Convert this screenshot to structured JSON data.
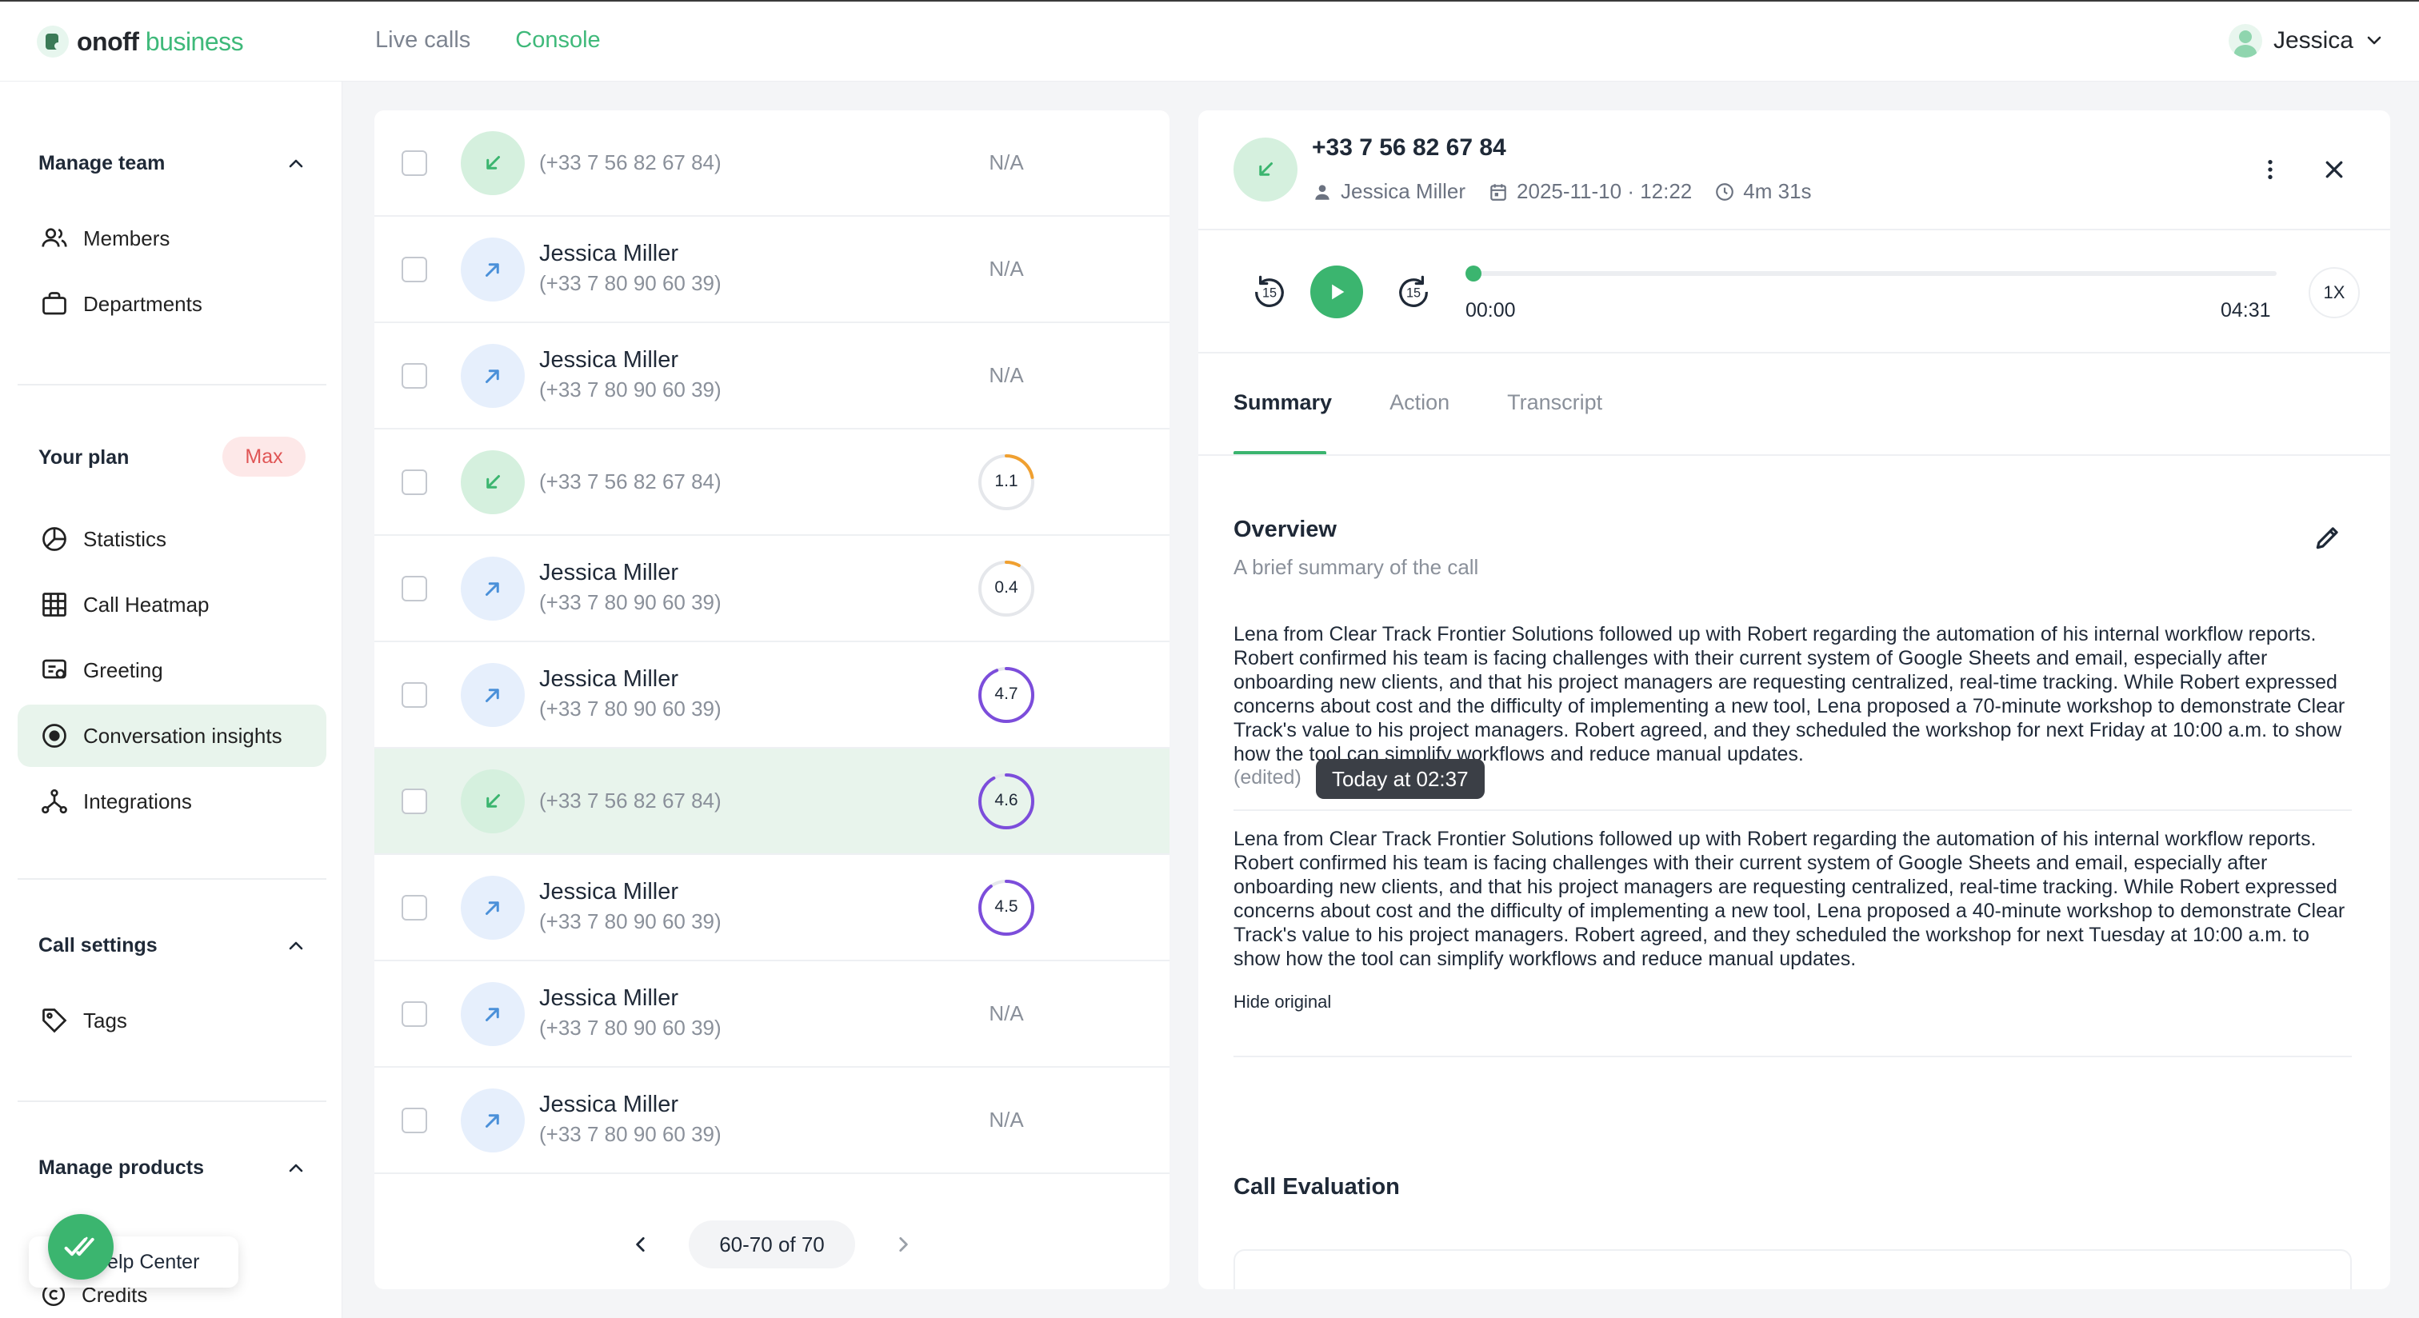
{
  "header": {
    "logo_bold": "onoff",
    "logo_light": " business",
    "nav": [
      {
        "label": "Live calls",
        "active": false
      },
      {
        "label": "Console",
        "active": true
      }
    ],
    "user_name": "Jessica"
  },
  "sidebar": {
    "manage_team": {
      "title": "Manage team",
      "items": [
        "Members",
        "Departments"
      ]
    },
    "plan": {
      "title": "Your plan",
      "badge": "Max",
      "items": [
        "Statistics",
        "Call Heatmap",
        "Greeting",
        "Conversation insights",
        "Integrations"
      ],
      "active": "Conversation insights"
    },
    "call_settings": {
      "title": "Call settings",
      "items": [
        "Tags"
      ]
    },
    "manage_products": {
      "title": "Manage products",
      "items": [
        "Help Center",
        "Credits"
      ]
    },
    "help_label": "Help Center",
    "credits_label": "Credits"
  },
  "call_list": {
    "rows": [
      {
        "direction": "in",
        "name": "",
        "number": "(+33 7 56 82 67 84)",
        "score": "N/A"
      },
      {
        "direction": "out",
        "name": "Jessica Miller",
        "number": "(+33 7 80 90 60 39)",
        "score": "N/A"
      },
      {
        "direction": "out",
        "name": "Jessica Miller",
        "number": "(+33 7 80 90 60 39)",
        "score": "N/A"
      },
      {
        "direction": "in",
        "name": "",
        "number": "(+33 7 56 82 67 84)",
        "score": "1.1"
      },
      {
        "direction": "out",
        "name": "Jessica Miller",
        "number": "(+33 7 80 90 60 39)",
        "score": "0.4"
      },
      {
        "direction": "out",
        "name": "Jessica Miller",
        "number": "(+33 7 80 90 60 39)",
        "score": "4.7"
      },
      {
        "direction": "in",
        "name": "",
        "number": "(+33 7 56 82 67 84)",
        "score": "4.6"
      },
      {
        "direction": "out",
        "name": "Jessica Miller",
        "number": "(+33 7 80 90 60 39)",
        "score": "4.5"
      },
      {
        "direction": "out",
        "name": "Jessica Miller",
        "number": "(+33 7 80 90 60 39)",
        "score": "N/A"
      },
      {
        "direction": "out",
        "name": "Jessica Miller",
        "number": "(+33 7 80 90 60 39)",
        "score": "N/A"
      }
    ],
    "score_ratios": [
      null,
      null,
      null,
      0.22,
      0.08,
      0.94,
      0.92,
      0.9,
      null,
      null
    ],
    "selected_index": 6,
    "pagination": "60-70 of 70"
  },
  "detail": {
    "phone": "+33 7 56 82 67 84",
    "agent": "Jessica Miller",
    "datetime": "2025-11-10 · 12:22",
    "duration": "4m 31s",
    "player": {
      "current": "00:00",
      "total": "04:31",
      "speed": "1X",
      "skip_back": "15",
      "skip_fwd": "15",
      "progress": 0.0
    },
    "tabs": [
      "Summary",
      "Action",
      "Transcript"
    ],
    "active_tab": "Summary",
    "overview_title": "Overview",
    "overview_sub": "A brief summary of the call",
    "summary_edited": "Lena from Clear Track Frontier Solutions followed up with Robert regarding the automation of his internal workflow reports. Robert confirmed his team is facing challenges with their current system of Google Sheets and email, especially after onboarding new clients, and that his project managers are requesting centralized, real-time tracking. While Robert expressed concerns about cost and the difficulty of implementing a new tool, Lena proposed a 70-minute workshop to demonstrate Clear Track's value to his project managers. Robert agreed, and they scheduled the workshop for next Friday at 10:00 a.m. to show how the tool can simplify workflows and reduce manual updates.",
    "edited_label": "(edited)",
    "tooltip": "Today at 02:37",
    "summary_original": "Lena from Clear Track Frontier Solutions followed up with Robert regarding the automation of his internal workflow reports. Robert confirmed his team is facing challenges with their current system of Google Sheets and email, especially after onboarding new clients, and that his project managers are requesting centralized, real-time tracking. While Robert expressed concerns about cost and the difficulty of implementing a new tool, Lena proposed a 40-minute workshop to demonstrate Clear Track's value to his project managers. Robert agreed, and they scheduled the workshop for next Tuesday at 10:00 a.m. to show how the tool can simplify workflows and reduce manual updates.",
    "hide_original": "Hide original",
    "evaluation_title": "Call Evaluation"
  },
  "colors": {
    "brand": "#3fb97a",
    "accent_green": "#3bb56f",
    "score_purple": "#7c4ddb",
    "score_orange": "#f0a030",
    "badge_red": "#e05555"
  }
}
